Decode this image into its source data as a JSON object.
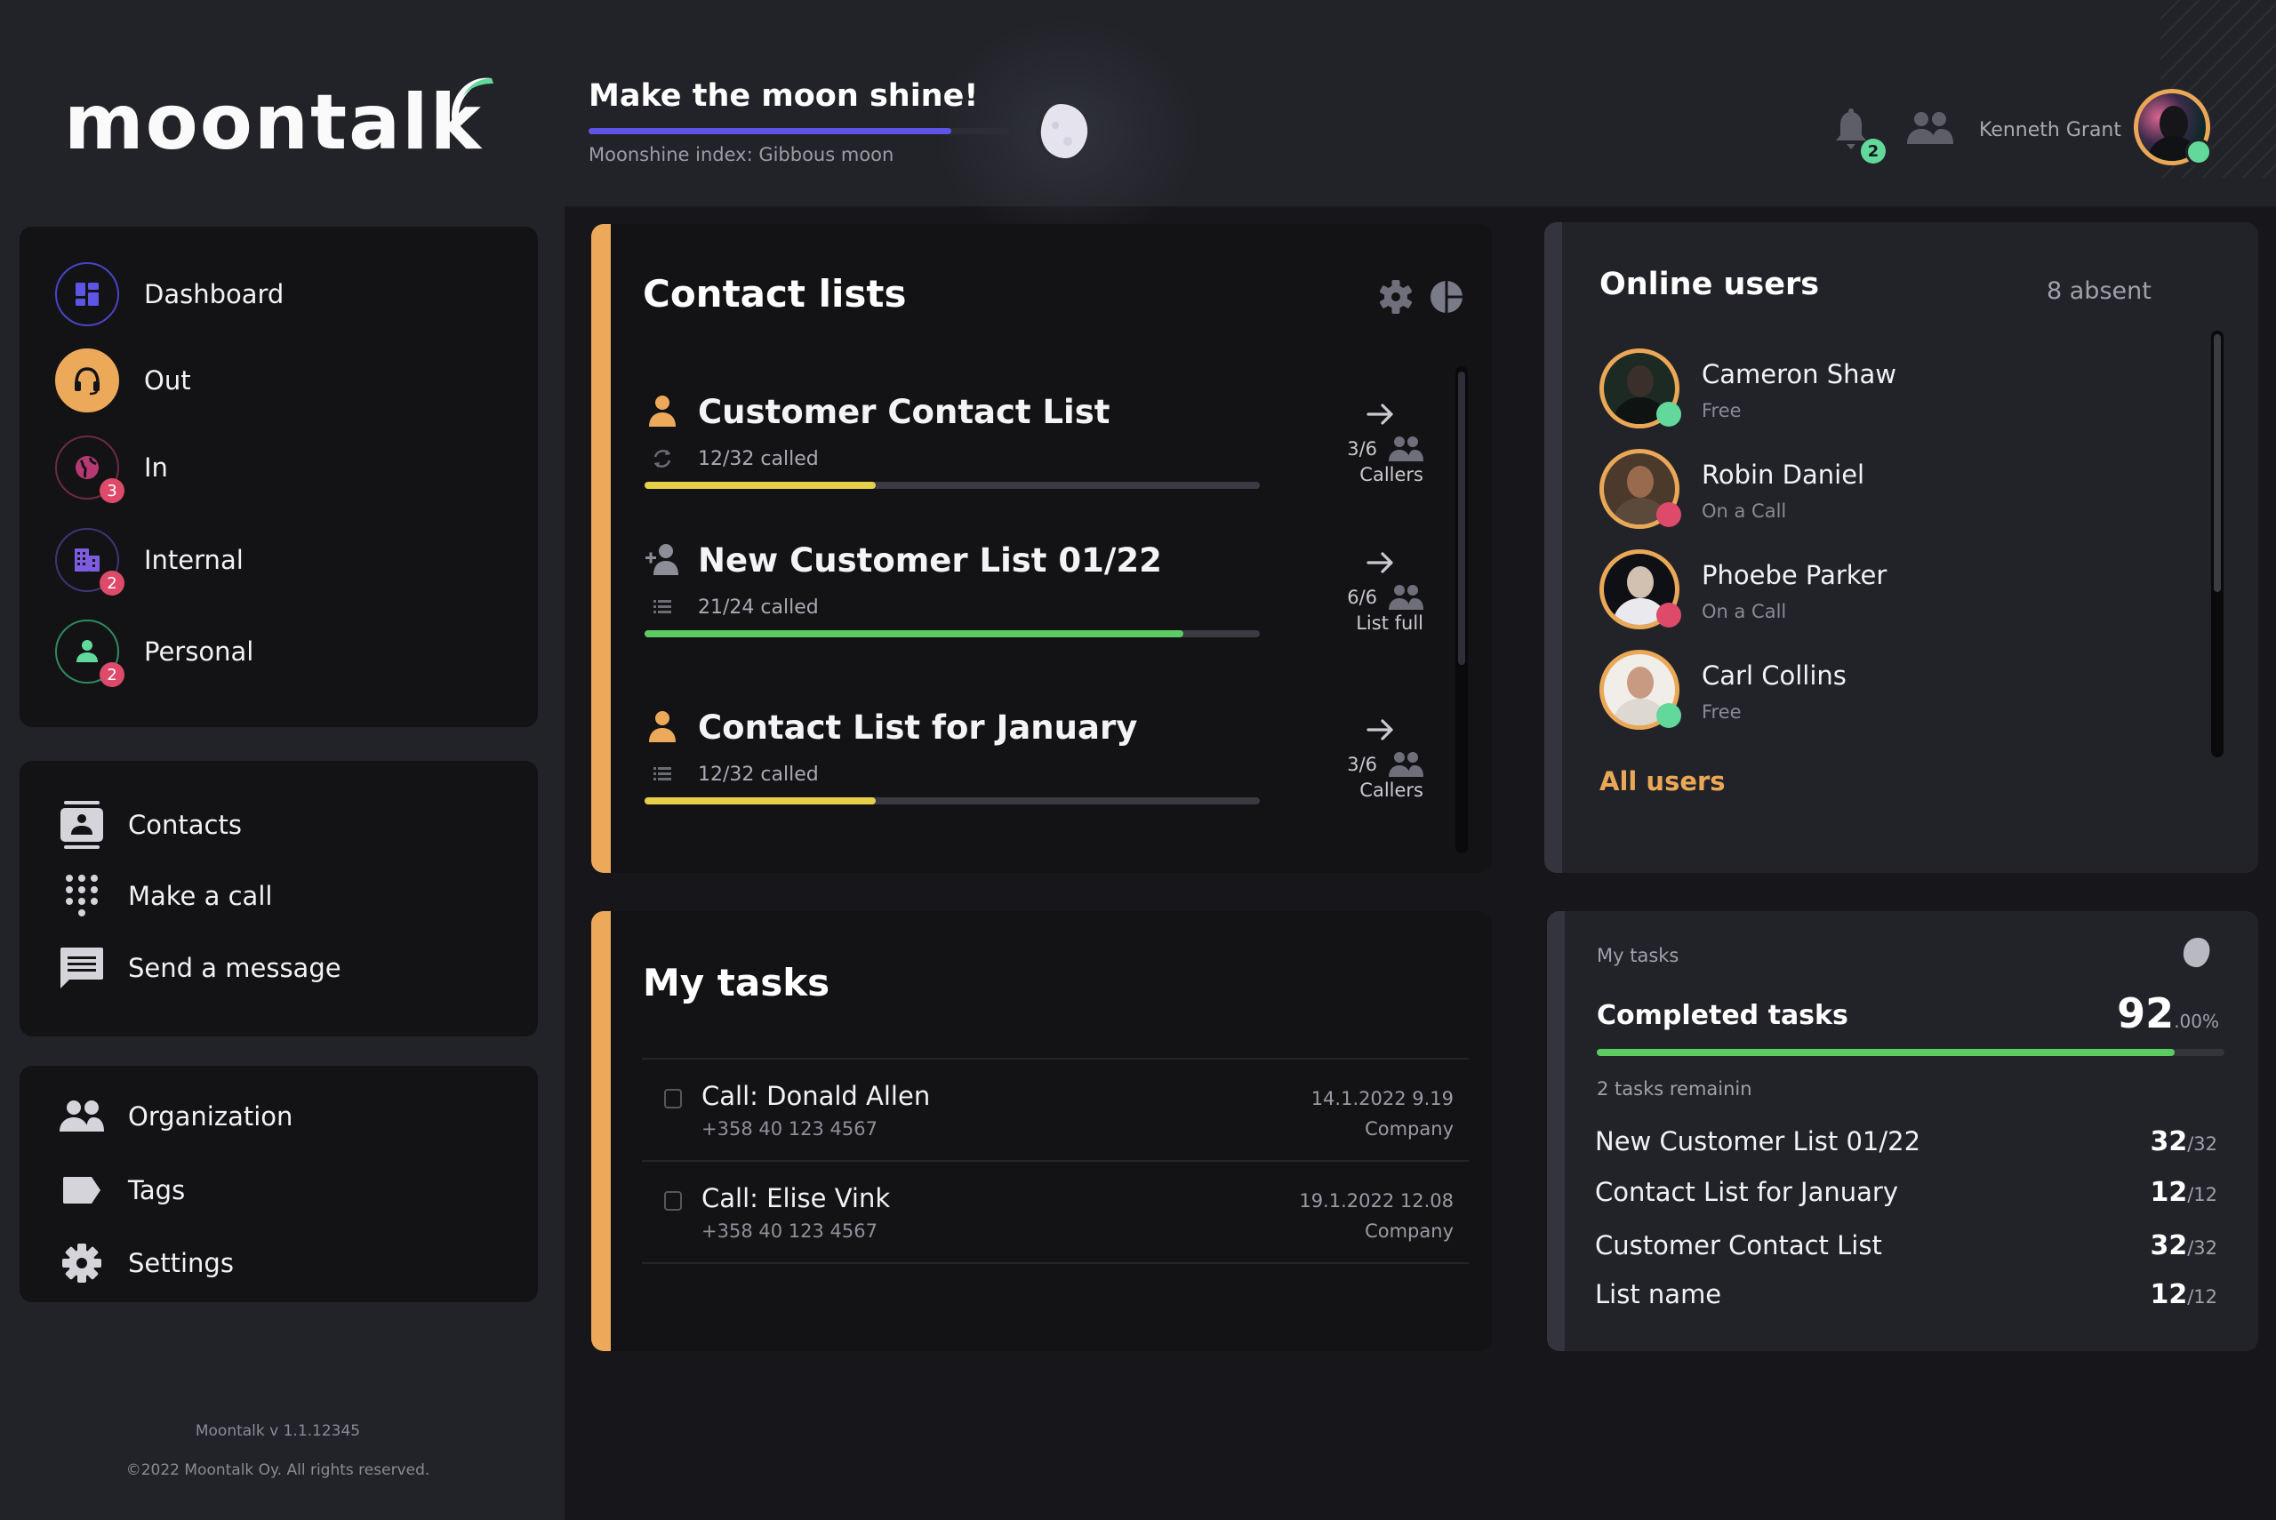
{
  "app": {
    "logo_text": "moontalk",
    "brand_colors": {
      "accent_orange": "#eda95a",
      "accent_purple": "#5c55e6",
      "accent_green": "#62d99a",
      "alert_red": "#dd4a6a"
    }
  },
  "header": {
    "moonshine": {
      "title": "Make the moon shine!",
      "progress_percent": 86,
      "subtitle": "Moonshine index: Gibbous moon",
      "icon": "gibbous-moon-icon"
    },
    "notifications": {
      "icon": "bell-icon",
      "count": "2"
    },
    "team_icon": "people-icon",
    "user": {
      "name": "Kenneth Grant",
      "status": "online"
    }
  },
  "sidebar": {
    "primary": [
      {
        "label": "Dashboard",
        "icon": "dashboard-grid-icon",
        "color": "#5c55e6",
        "badge": null,
        "active": false
      },
      {
        "label": "Out",
        "icon": "headset-icon",
        "color": "#eda95a",
        "badge": null,
        "active": true
      },
      {
        "label": "In",
        "icon": "globe-icon",
        "color": "#b63a72",
        "badge": "3",
        "active": false
      },
      {
        "label": "Internal",
        "icon": "building-icon",
        "color": "#7d5ce0",
        "badge": "2",
        "active": false
      },
      {
        "label": "Personal",
        "icon": "person-icon",
        "color": "#62d99a",
        "badge": "2",
        "active": false
      }
    ],
    "secondary": [
      {
        "label": "Contacts",
        "icon": "contacts-book-icon"
      },
      {
        "label": "Make a call",
        "icon": "dialpad-icon"
      },
      {
        "label": "Send a message",
        "icon": "message-icon"
      }
    ],
    "tertiary": [
      {
        "label": "Organization",
        "icon": "organization-icon"
      },
      {
        "label": "Tags",
        "icon": "tag-icon"
      },
      {
        "label": "Settings",
        "icon": "gear-icon"
      }
    ],
    "footer": {
      "version": "Moontalk v 1.1.12345",
      "copyright": "©2022 Moontalk Oy. All rights reserved."
    }
  },
  "contact_lists": {
    "title": "Contact lists",
    "settings_icon": "gear-icon",
    "chart_icon": "pie-chart-icon",
    "items": [
      {
        "name": "Customer Contact List",
        "icon": "person-icon",
        "icon_color": "#eda95a",
        "sub_icon": "refresh-icon",
        "called": "12/32 called",
        "progress": 0.375,
        "bar_color": "#e8cf48",
        "callers": "3/6",
        "caption": "Callers"
      },
      {
        "name": "New Customer List 01/22",
        "icon": "add-person-icon",
        "icon_color": "#8d8d98",
        "sub_icon": "list-icon",
        "called": "21/24 called",
        "progress": 0.875,
        "bar_color": "#5ccb62",
        "callers": "6/6",
        "caption": "List full"
      },
      {
        "name": "Contact List for January",
        "icon": "person-icon",
        "icon_color": "#eda95a",
        "sub_icon": "list-icon",
        "called": "12/32 called",
        "progress": 0.375,
        "bar_color": "#e8cf48",
        "callers": "3/6",
        "caption": "Callers"
      }
    ]
  },
  "my_tasks": {
    "title": "My tasks",
    "items": [
      {
        "name": "Call: Donald Allen",
        "phone": "+358 40 123 4567",
        "date": "14.1.2022 9.19",
        "company": "Company",
        "checked": false
      },
      {
        "name": "Call: Elise Vink",
        "phone": "+358 40 123 4567",
        "date": "19.1.2022 12.08",
        "company": "Company",
        "checked": false
      }
    ]
  },
  "online_users": {
    "title": "Online users",
    "absent": "8 absent",
    "users": [
      {
        "name": "Cameron Shaw",
        "status": "Free",
        "status_color": "#62d99a"
      },
      {
        "name": "Robin Daniel",
        "status": "On a Call",
        "status_color": "#dd4a6a"
      },
      {
        "name": "Phoebe Parker",
        "status": "On a Call",
        "status_color": "#dd4a6a"
      },
      {
        "name": "Carl Collins",
        "status": "Free",
        "status_color": "#62d99a"
      }
    ],
    "all_users_link": "All users"
  },
  "task_summary": {
    "label": "My tasks",
    "completed_label": "Completed tasks",
    "percent_int": "92",
    "percent_dec": ".00%",
    "progress_percent": 92,
    "remaining": "2 tasks remainin",
    "lists": [
      {
        "name": "New Customer List 01/22",
        "done": "32",
        "total": "/32"
      },
      {
        "name": "Contact List for January",
        "done": "12",
        "total": "/12"
      },
      {
        "name": "Customer Contact List",
        "done": "32",
        "total": "/32"
      },
      {
        "name": "List name",
        "done": "12",
        "total": "/12"
      }
    ]
  }
}
